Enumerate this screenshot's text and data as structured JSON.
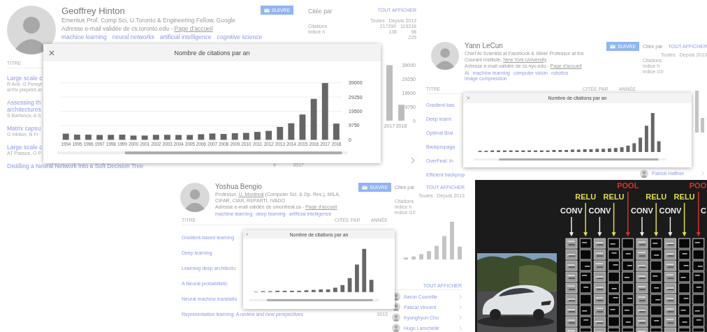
{
  "profiles": [
    {
      "name": "Geoffrey Hinton",
      "affiliation": [
        {
          "kind": "text",
          "text": "Emeritus Prof. Comp Sci, U.Toronto & Engineering Fellow, Google"
        }
      ],
      "email": "Adresse e-mail validée de cs.toronto.edu - ",
      "homepage": "Page d'accueil",
      "tags": [
        "machine learning",
        "neural networks",
        "artificial intelligence",
        "cognitive science"
      ],
      "follow_button": "SUIVRE",
      "cited_by": {
        "title": "Citée par",
        "link": "TOUT AFFICHER",
        "columns": [
          "Toutes",
          "Depuis 2013"
        ],
        "rows": [
          {
            "label": "Citations",
            "values": [
              "217290",
              "115318"
            ]
          },
          {
            "label": "indice h",
            "values": [
              "138",
              "98"
            ]
          },
          {
            "values": [
              "225"
            ]
          }
        ]
      },
      "articles_header": [
        {
          "kind": "title",
          "text": "TITRE"
        }
      ],
      "articles": [
        {
          "title": [
            "Large scale c"
          ],
          "details": [
            "R Anil, G Pereyr",
            "arXiv preprint ar"
          ]
        },
        {
          "title": [
            "Assessing th",
            "architectures"
          ],
          "details": [
            "S Bartunov, A S"
          ]
        },
        {
          "title": [
            "Matrix capsu"
          ],
          "details": [
            "G Hinton, N Fr"
          ]
        },
        {
          "title": [
            "Large scale c"
          ],
          "details": [
            "AT Passos, O P"
          ]
        },
        {
          "title": [
            "Distilling a Neural Network Into a Soft Decision Tree"
          ],
          "citations": "4",
          "year": "2017"
        }
      ],
      "side_chart": {
        "chart_data": {
          "type": "bar",
          "categories": [
            "2017",
            "2018"
          ],
          "values": [
            38800,
            11100
          ],
          "ylim": [
            0,
            39000
          ],
          "yticks": [
            0,
            9750,
            19500,
            29250,
            39000
          ]
        }
      },
      "modal": {
        "title": "Nombre de citations par an",
        "chart_data": {
          "type": "bar",
          "categories": [
            "1994",
            "1995",
            "1996",
            "1997",
            "1998",
            "1999",
            "2000",
            "2001",
            "2002",
            "2003",
            "2004",
            "2005",
            "2006",
            "2007",
            "2008",
            "2009",
            "2010",
            "2011",
            "2012",
            "2013",
            "2014",
            "2015",
            "2016",
            "2017",
            "2018"
          ],
          "values": [
            4200,
            3500,
            3500,
            3300,
            3400,
            3500,
            2900,
            2900,
            3400,
            3400,
            3300,
            3300,
            3800,
            4300,
            4000,
            4500,
            4700,
            5400,
            6100,
            8800,
            11300,
            17300,
            28000,
            38800,
            11100
          ],
          "ylim": [
            0,
            39000
          ],
          "yticks": [
            0,
            9750,
            19500,
            29250,
            39000
          ],
          "grid": true
        }
      }
    },
    {
      "name": "Yann LeCun",
      "affiliation": [
        {
          "kind": "text",
          "text": "Chief AI Scientist at Facebook & Silver Professor at the Courant Institute, "
        },
        {
          "kind": "link",
          "text": "New York University"
        }
      ],
      "email": "Adresse e-mail validée de cs.nyu.edu - ",
      "homepage": "Page d'accueil",
      "tags": [
        "AI",
        "machine learning",
        "computer vision",
        "robotics",
        "image compression"
      ],
      "follow_button": "SUIVRE",
      "cited_by": {
        "title": "Citée par",
        "link": "TOUT AFFICHER",
        "columns": [
          "Toutes",
          "Depuis 2013"
        ],
        "rows": [
          {
            "label": "Citations"
          },
          {
            "label": "indice h"
          },
          {
            "label": "indice i10"
          }
        ]
      },
      "articles_header": [
        {
          "kind": "title",
          "text": "TITRE"
        },
        {
          "kind": "cited",
          "text": "CITÉE PAR"
        },
        {
          "kind": "year",
          "text": "ANNÉE"
        }
      ],
      "articles": [
        {
          "title": [
            "Gradient-bas"
          ]
        },
        {
          "title": [
            "Deep learni"
          ]
        },
        {
          "title": [
            "Optimal Brai"
          ]
        },
        {
          "title": [
            "Backpropaga"
          ]
        },
        {
          "title": [
            "OverFeat: In"
          ]
        },
        {
          "title": [
            "Efficient backprop"
          ]
        }
      ],
      "coauthors": [
        {
          "name": "Patrick Haffner"
        }
      ],
      "modal": {
        "title": "Nombre de citations par an"
      }
    },
    {
      "name": "Yoshua Bengio",
      "affiliation": [
        {
          "kind": "text",
          "text": "Professor, "
        },
        {
          "kind": "link",
          "text": "U. Montreal"
        },
        {
          "kind": "text",
          "text": " (Computer Sci. & Op. Res.), MILA, CIFAR, CIAR, REPARTI, IVADO"
        }
      ],
      "email": "Adresse e-mail validée de umontreal.ca - ",
      "homepage": "Page d'accueil",
      "tags": [
        "machine learning",
        "deep learning",
        "artificial intelligence"
      ],
      "follow_button": "SUIVRE",
      "cited_by": {
        "title": "Citée par",
        "link": "TOUT AFFICHER",
        "columns": [
          "Toutes",
          "Depuis 2013"
        ],
        "rows": [
          {
            "label": "Citations"
          },
          {
            "label": "indice h"
          },
          {
            "label": "indice i10"
          }
        ]
      },
      "articles_header": [
        {
          "kind": "title",
          "text": "TITRE"
        },
        {
          "kind": "cited",
          "text": "CITÉE PAR"
        },
        {
          "kind": "year",
          "text": "ANNÉE"
        }
      ],
      "articles": [
        {
          "title": [
            "Gradient-based learning"
          ]
        },
        {
          "title": [
            "Deep learning"
          ]
        },
        {
          "title": [
            "Learning deep architectu"
          ]
        },
        {
          "title": [
            "A Neural probabilistic"
          ]
        },
        {
          "title": [
            "Neural machine translatio"
          ]
        },
        {
          "title": [
            "Representation learning: A review and new perspectives"
          ],
          "year": "2013"
        }
      ],
      "coauthors_link": "TOUT AFFICHER",
      "coauthors": [
        {
          "name": "Aaron Courville"
        },
        {
          "name": "Pascal Vincent"
        },
        {
          "name": "Kyunghyun Cho"
        },
        {
          "name": "Hugo Larochelle"
        }
      ],
      "modal": {
        "title": "Nombre de citations par an"
      }
    }
  ],
  "cnn": {
    "layers": [
      {
        "kind": "conv",
        "label": "CONV"
      },
      {
        "kind": "relu",
        "label": "RELU"
      },
      {
        "kind": "conv",
        "label": "CONV"
      },
      {
        "kind": "relu",
        "label": "RELU"
      },
      {
        "kind": "pool",
        "label": "POOL"
      },
      {
        "kind": "conv",
        "label": "CONV"
      },
      {
        "kind": "relu",
        "label": "RELU"
      },
      {
        "kind": "conv",
        "label": "CONV"
      },
      {
        "kind": "relu",
        "label": "RELU"
      },
      {
        "kind": "pool",
        "label": "POO"
      },
      {
        "kind": "conv",
        "label": "C"
      }
    ]
  }
}
